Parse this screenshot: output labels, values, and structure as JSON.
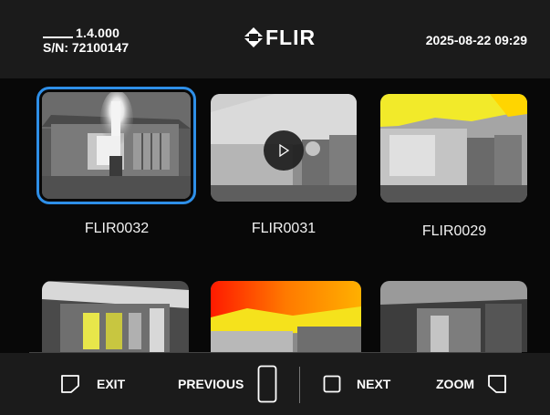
{
  "header": {
    "version": "1.4.000",
    "serial": "S/N: 72100147",
    "logo_text": "FLIR",
    "datetime": "2025-08-22 09:29"
  },
  "gallery": {
    "items": [
      {
        "label": "FLIR0032",
        "selected": true,
        "type": "image"
      },
      {
        "label": "FLIR0031",
        "selected": false,
        "type": "video"
      },
      {
        "label": "FLIR0029",
        "selected": false,
        "type": "image"
      },
      {
        "label": "",
        "selected": false,
        "type": "image"
      },
      {
        "label": "",
        "selected": false,
        "type": "image"
      },
      {
        "label": "",
        "selected": false,
        "type": "image"
      }
    ]
  },
  "toolbar": {
    "exit_label": "EXIT",
    "previous_label": "PREVIOUS",
    "next_label": "NEXT",
    "zoom_label": "ZOOM"
  },
  "colors": {
    "selection": "#2e8fe8",
    "header_bg": "#1b1b1b",
    "background": "#080808"
  }
}
